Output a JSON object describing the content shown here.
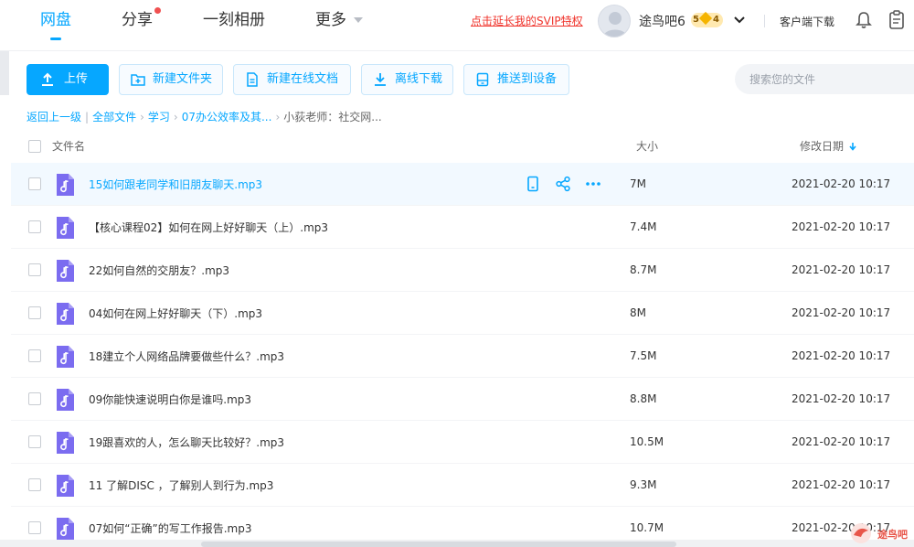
{
  "nav": {
    "tabs": [
      {
        "label": "网盘"
      },
      {
        "label": "分享"
      },
      {
        "label": "一刻相册"
      },
      {
        "label": "更多"
      }
    ],
    "svip_link": "点击延长我的SVIP特权",
    "username": "途鸟吧6",
    "vip_level": "5",
    "vip_level_sub": "4",
    "client_download": "客户端下载"
  },
  "toolbar": {
    "upload": "上传",
    "new_folder": "新建文件夹",
    "new_doc": "新建在线文档",
    "offline_download": "离线下载",
    "push_device": "推送到设备",
    "search_placeholder": "搜索您的文件"
  },
  "breadcrumb": {
    "back": "返回上一级",
    "items": [
      "全部文件",
      "学习",
      "07办公效率及其..."
    ],
    "current": "小荻老师：社交网..."
  },
  "table": {
    "columns": {
      "name": "文件名",
      "size": "大小",
      "date": "修改日期"
    },
    "rows": [
      {
        "name": "15如何跟老同学和旧朋友聊天.mp3",
        "size": "7M",
        "date": "2021-02-20 10:17"
      },
      {
        "name": "【核心课程02】如何在网上好好聊天（上）.mp3",
        "size": "7.4M",
        "date": "2021-02-20 10:17"
      },
      {
        "name": "22如何自然的交朋友？.mp3",
        "size": "8.7M",
        "date": "2021-02-20 10:17"
      },
      {
        "name": "04如何在网上好好聊天（下）.mp3",
        "size": "8M",
        "date": "2021-02-20 10:17"
      },
      {
        "name": "18建立个人网络品牌要做些什么？.mp3",
        "size": "7.5M",
        "date": "2021-02-20 10:17"
      },
      {
        "name": "09你能快速说明白你是谁吗.mp3",
        "size": "8.8M",
        "date": "2021-02-20 10:17"
      },
      {
        "name": "19跟喜欢的人，怎么聊天比较好？.mp3",
        "size": "10.5M",
        "date": "2021-02-20 10:17"
      },
      {
        "name": "11 了解DISC ，了解别人到行为.mp3",
        "size": "9.3M",
        "date": "2021-02-20 10:17"
      },
      {
        "name": "07如何“正确”的写工作报告.mp3",
        "size": "10.7M",
        "date": "2021-02-20 10:17"
      }
    ]
  },
  "watermark": "途鸟吧",
  "colors": {
    "accent": "#06a7ff",
    "svip_red": "#f0332b",
    "audio_icon": "#7b6cf0",
    "hover_row": "#f2f9ff"
  }
}
